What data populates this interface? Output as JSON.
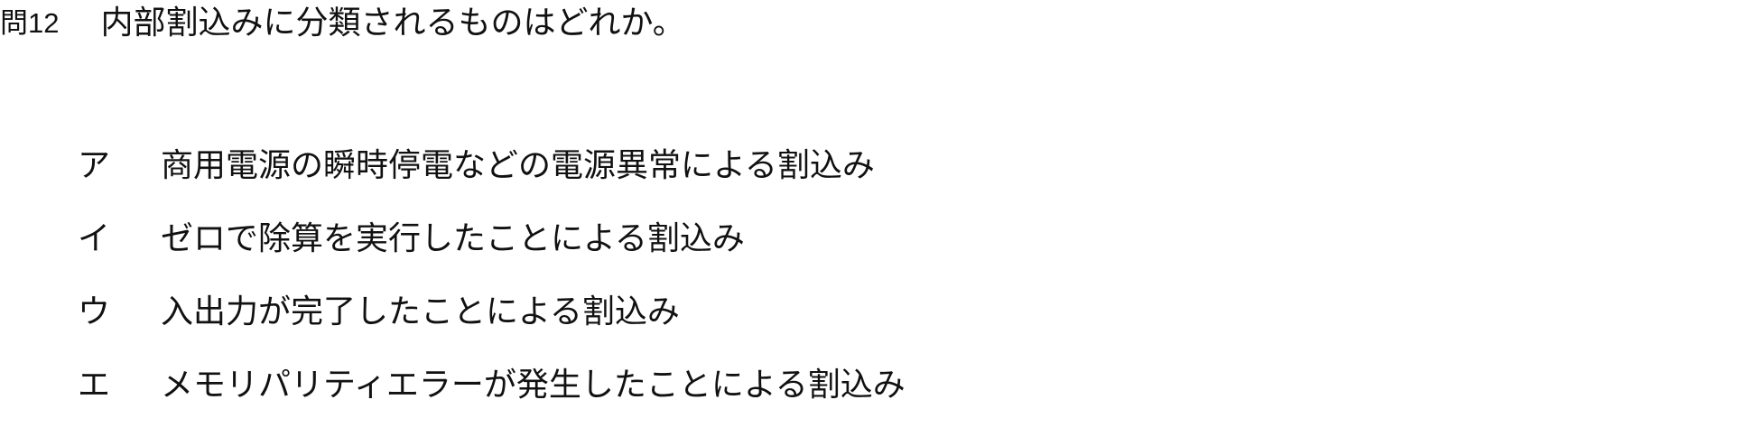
{
  "question": {
    "number": "問12",
    "text": "内部割込みに分類されるものはどれか。"
  },
  "choices": [
    {
      "label": "ア",
      "text": "商用電源の瞬時停電などの電源異常による割込み"
    },
    {
      "label": "イ",
      "text": "ゼロで除算を実行したことによる割込み"
    },
    {
      "label": "ウ",
      "text": "入出力が完了したことによる割込み"
    },
    {
      "label": "エ",
      "text": "メモリパリティエラーが発生したことによる割込み"
    }
  ]
}
